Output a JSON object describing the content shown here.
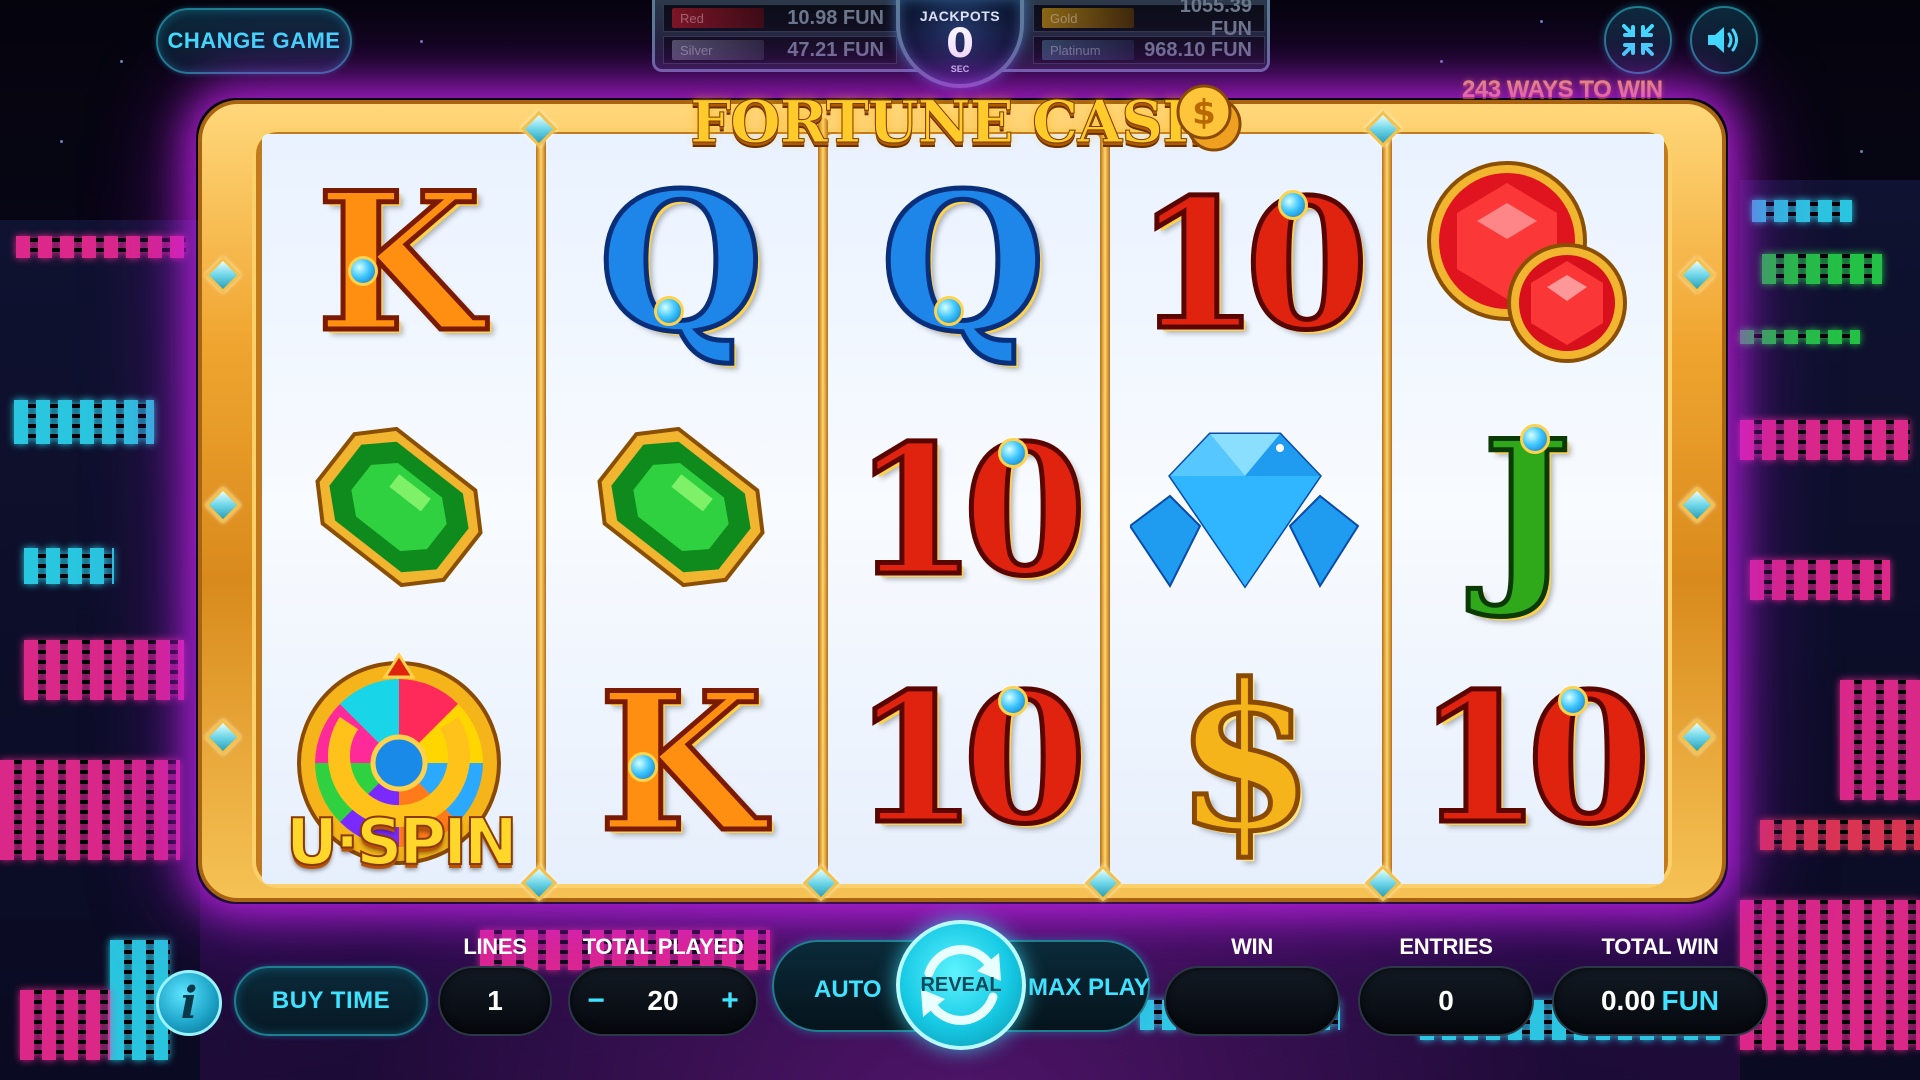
{
  "header": {
    "change_game": "CHANGE GAME",
    "ways_to_win": "243 WAYS TO WIN"
  },
  "jackpots": {
    "title": "JACKPOTS",
    "timer_value": "0",
    "timer_unit": "SEC",
    "items": [
      {
        "name": "Red",
        "value": "10.98 FUN"
      },
      {
        "name": "Silver",
        "value": "47.21 FUN"
      },
      {
        "name": "Gold",
        "value": "1055.39 FUN"
      },
      {
        "name": "Platinum",
        "value": "968.10 FUN"
      }
    ]
  },
  "game": {
    "title": "FORTUNE CASH",
    "reels": [
      [
        "K",
        "emerald",
        "u-spin"
      ],
      [
        "Q",
        "emerald",
        "K"
      ],
      [
        "Q",
        "10",
        "10"
      ],
      [
        "10",
        "diamond",
        "dollar"
      ],
      [
        "ruby",
        "J",
        "10"
      ]
    ],
    "u_spin_label": "U·SPIN"
  },
  "controls": {
    "buy_time": "BUY TIME",
    "lines_label": "LINES",
    "lines_value": "1",
    "total_played_label": "TOTAL PLAYED",
    "total_played_value": "20",
    "minus": "−",
    "plus": "+",
    "auto": "AUTO",
    "reveal": "REVEAL",
    "max_play": "MAX PLAY",
    "win_label": "WIN",
    "win_value": "",
    "entries_label": "ENTRIES",
    "entries_value": "0",
    "total_win_label": "TOTAL WIN",
    "total_win_value": "0.00",
    "total_win_unit": "FUN"
  },
  "icons": {
    "fullscreen": "compress-icon",
    "sound": "speaker-icon",
    "info": "info-icon",
    "reveal": "refresh-icon"
  },
  "colors": {
    "accent_cyan": "#3fe2ff",
    "frame_gold": "#f0a530",
    "neon_purple": "#dc28ff"
  }
}
